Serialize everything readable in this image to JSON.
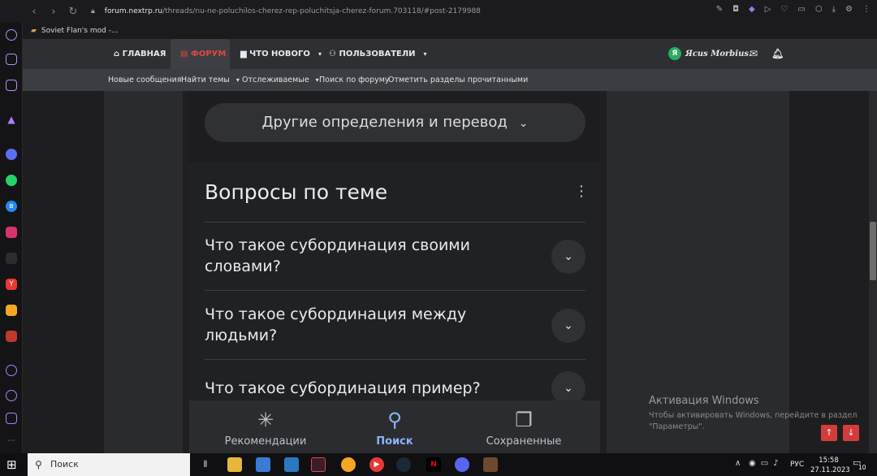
{
  "browser": {
    "url_domain": "forum.nextrp.ru",
    "url_path": "/threads/nu-ne-poluchilos-cherez-rep-poluchitsja-cherez-forum.703118/#post-2179988",
    "bookmark": "Soviet Flan's mod -..."
  },
  "forum": {
    "nav": [
      "ГЛАВНАЯ",
      "ФОРУМ",
      "ЧТО НОВОГО",
      "ПОЛЬЗОВАТЕЛИ"
    ],
    "user": "Ясиs Morbius.",
    "avatar_letter": "Я",
    "subnav": [
      "Новые сообщения",
      "Найти темы",
      "Отслеживаемые",
      "Поиск по форуму",
      "Отметить разделы прочитанными"
    ]
  },
  "phone": {
    "pill": "Другие определения и перевод",
    "section_title": "Вопросы по теме",
    "questions": [
      "Что такое субординация своими словами?",
      "Что такое субординация между людьми?",
      "Что такое субординация пример?"
    ],
    "bottom_nav": [
      "Рекомендации",
      "Поиск",
      "Сохраненные"
    ]
  },
  "windows_activation": {
    "title": "Активация Windows",
    "text": "Чтобы активировать Windows, перейдите в раздел \"Параметры\"."
  },
  "taskbar": {
    "search_placeholder": "Поиск",
    "lang": "РУС",
    "time": "15:58",
    "date": "27.11.2023",
    "notif_count": "10"
  },
  "colors": {
    "accent_red": "#e0483e",
    "google_blue": "#8ab4f8",
    "forum_header": "#2d2f33"
  }
}
